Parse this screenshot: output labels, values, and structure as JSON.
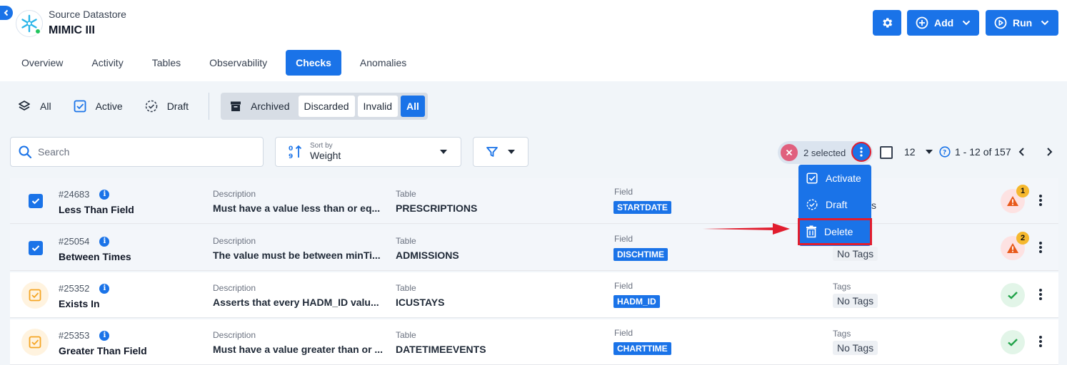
{
  "header": {
    "kicker": "Source Datastore",
    "name": "MIMIC III",
    "add_label": "Add",
    "run_label": "Run"
  },
  "tabs": [
    {
      "label": "Overview"
    },
    {
      "label": "Activity"
    },
    {
      "label": "Tables"
    },
    {
      "label": "Observability"
    },
    {
      "label": "Checks"
    },
    {
      "label": "Anomalies"
    }
  ],
  "active_tab": "Checks",
  "filters": {
    "all": "All",
    "active": "Active",
    "draft": "Draft",
    "archived": "Archived",
    "discarded": "Discarded",
    "invalid": "Invalid",
    "all_btn": "All"
  },
  "search": {
    "placeholder": "Search"
  },
  "sort": {
    "kicker": "Sort by",
    "value": "Weight"
  },
  "selection": {
    "count_label": "2 selected"
  },
  "pagination": {
    "page_size": "12",
    "range": "1 - 12 of 157"
  },
  "menu": {
    "activate": "Activate",
    "draft": "Draft",
    "delete": "Delete"
  },
  "labels": {
    "description": "Description",
    "table": "Table",
    "field": "Field",
    "tags": "Tags"
  },
  "rows": [
    {
      "id": "#24683",
      "name": "Less Than Field",
      "description": "Must have a value less than or eq...",
      "table": "PRESCRIPTIONS",
      "field": "STARTDATE",
      "tags_partial": "s",
      "status": "warning",
      "anomaly_count": "1",
      "selected": true
    },
    {
      "id": "#25054",
      "name": "Between Times",
      "description": "The value must be between minTi...",
      "table": "ADMISSIONS",
      "field": "DISCHTIME",
      "tags": "No Tags",
      "status": "warning",
      "anomaly_count": "2",
      "selected": true
    },
    {
      "id": "#25352",
      "name": "Exists In",
      "description": "Asserts that every HADM_ID valu...",
      "table": "ICUSTAYS",
      "field": "HADM_ID",
      "tags": "No Tags",
      "status": "ok",
      "selected": false
    },
    {
      "id": "#25353",
      "name": "Greater Than Field",
      "description": "Must have a value greater than or ...",
      "table": "DATETIMEEVENTS",
      "field": "CHARTTIME",
      "tags": "No Tags",
      "status": "ok",
      "selected": false
    }
  ],
  "colors": {
    "primary": "#1a73e8",
    "highlight": "#e11d2e",
    "warning": "#e8591a",
    "success": "#22a34a"
  }
}
